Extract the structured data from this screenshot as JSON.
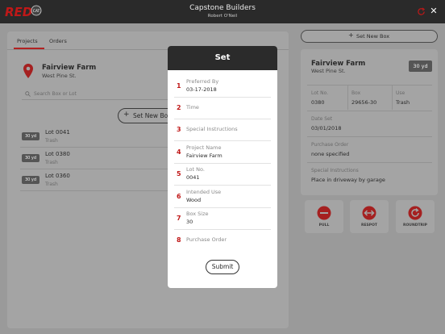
{
  "header": {
    "title": "Capstone Builders",
    "subtitle": "Robert O'Neil",
    "logo_text": "RED",
    "logo_badge": "CAT"
  },
  "colors": {
    "accent": "#c01818",
    "dark": "#2b2b2b"
  },
  "tabs": [
    {
      "label": "Projects",
      "active": true
    },
    {
      "label": "Orders",
      "active": false
    }
  ],
  "project": {
    "name": "Fairview Farm",
    "address": "West Pine St."
  },
  "search": {
    "placeholder": "Search Box or Lot"
  },
  "set_new_box_label": "Set New Box",
  "lots": [
    {
      "badge": "30 yd",
      "name": "Lot 0041",
      "type": "Trash"
    },
    {
      "badge": "30 yd",
      "name": "Lot 0380",
      "type": "Trash"
    },
    {
      "badge": "30 yd",
      "name": "Lot 0360",
      "type": "Trash"
    }
  ],
  "detail": {
    "name": "Fairview Farm",
    "address": "West Pine St.",
    "badge": "30 yd",
    "lot_label": "Lot No.",
    "lot_value": "0380",
    "box_label": "Box",
    "box_value": "29656-30",
    "use_label": "Use",
    "use_value": "Trash",
    "date_label": "Date Set",
    "date_value": "03/01/2018",
    "po_label": "Purchase Order",
    "po_value": "none specified",
    "si_label": "Special Instructions",
    "si_value": "Place in driveway by garage"
  },
  "actions": [
    {
      "label": "PULL",
      "icon": "minus-circle-icon"
    },
    {
      "label": "RESPOT",
      "icon": "respot-arrows-icon"
    },
    {
      "label": "ROUNDTRIP",
      "icon": "roundtrip-icon"
    }
  ],
  "modal": {
    "title": "Set",
    "fields": [
      {
        "num": "1",
        "label": "Preferred By",
        "value": "03-17-2018"
      },
      {
        "num": "2",
        "label": "Time",
        "value": ""
      },
      {
        "num": "3",
        "label": "Special Instructions",
        "value": ""
      },
      {
        "num": "4",
        "label": "Project Name",
        "value": "Fairview Farm"
      },
      {
        "num": "5",
        "label": "Lot No.",
        "value": "0041"
      },
      {
        "num": "6",
        "label": "Intended Use",
        "value": "Wood"
      },
      {
        "num": "7",
        "label": "Box Size",
        "value": "30"
      },
      {
        "num": "8",
        "label": "Purchase Order",
        "value": ""
      }
    ],
    "submit_label": "Submit"
  }
}
